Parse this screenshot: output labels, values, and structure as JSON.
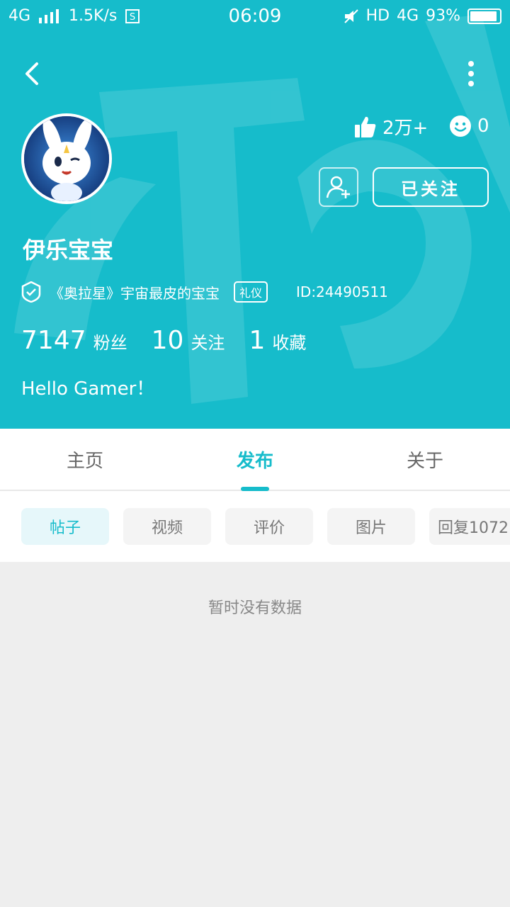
{
  "status_bar": {
    "network": "4G",
    "speed": "1.5K/s",
    "time": "06:09",
    "hd": "HD",
    "network_right": "4G",
    "battery_text": "93%",
    "battery_level": 0.93
  },
  "profile": {
    "username": "伊乐宝宝",
    "likes": "2万+",
    "smiles": "0",
    "follow_label": "已关注",
    "title_text": "《奥拉星》宇宙最皮的宝宝",
    "tag": "礼仪",
    "id_text": "ID:24490511",
    "stats": [
      {
        "value": "7147",
        "label": "粉丝"
      },
      {
        "value": "10",
        "label": "关注"
      },
      {
        "value": "1",
        "label": "收藏"
      }
    ],
    "bio": "Hello Gamer！"
  },
  "tabs": [
    {
      "label": "主页",
      "active": false
    },
    {
      "label": "发布",
      "active": true
    },
    {
      "label": "关于",
      "active": false
    }
  ],
  "chips": [
    {
      "label": "帖子",
      "active": true
    },
    {
      "label": "视频",
      "active": false
    },
    {
      "label": "评价",
      "active": false
    },
    {
      "label": "图片",
      "active": false
    },
    {
      "label": "回复1072",
      "active": false
    }
  ],
  "empty_text": "暂时没有数据",
  "colors": {
    "primary": "#16bccb",
    "page_bg": "#eeeeee"
  }
}
